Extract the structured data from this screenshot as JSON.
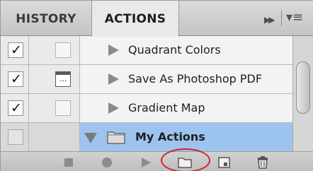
{
  "tabs": {
    "history": "HISTORY",
    "actions": "ACTIONS"
  },
  "header_icons": [
    "fast-forward-icon",
    "panel-menu-icon"
  ],
  "rows": [
    {
      "name": "Quadrant Colors",
      "checked": true,
      "dialog": false,
      "type": "action"
    },
    {
      "name": "Save As Photoshop PDF",
      "checked": true,
      "dialog": true,
      "type": "action"
    },
    {
      "name": "Gradient Map",
      "checked": true,
      "dialog": false,
      "type": "action"
    },
    {
      "name": "My Actions",
      "checked": false,
      "dialog": false,
      "type": "set",
      "selected": true
    }
  ],
  "footer_buttons": [
    "stop-icon",
    "record-icon",
    "play-icon",
    "new-set-folder-icon",
    "new-action-icon",
    "trash-icon"
  ],
  "colors": {
    "selected_row": "#9cc4ee",
    "highlight_ring": "#d0232a"
  }
}
